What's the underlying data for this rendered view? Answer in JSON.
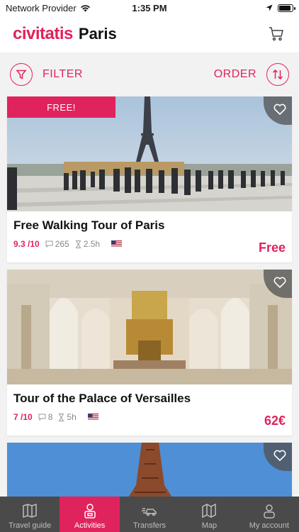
{
  "status": {
    "carrier": "Network Provider",
    "time": "1:35 PM",
    "battery_level": 0.9
  },
  "header": {
    "logo": "civitatis",
    "city": "Paris",
    "cart_icon": "cart-icon"
  },
  "toolbar": {
    "filter_label": "FILTER",
    "order_label": "ORDER",
    "filter_icon": "funnel-icon",
    "order_icon": "sort-arrows-icon"
  },
  "colors": {
    "brand": "#e0235c",
    "tab_bar": "#4a4a4a",
    "background": "#f2f2f2"
  },
  "activities": [
    {
      "badge": "FREE!",
      "title": "Free Walking Tour of Paris",
      "rating": "9.3 /10",
      "reviews": "265",
      "duration": "2.5h",
      "language_flag": "us-flag",
      "price": "Free"
    },
    {
      "title": "Tour of the Palace of Versailles",
      "rating": "7 /10",
      "reviews": "8",
      "duration": "5h",
      "language_flag": "us-flag",
      "price": "62€"
    },
    {
      "title": ""
    }
  ],
  "tabs": [
    {
      "label": "Travel guide",
      "icon": "map-book-icon",
      "active": false
    },
    {
      "label": "Activities",
      "icon": "person-badge-icon",
      "active": true
    },
    {
      "label": "Transfers",
      "icon": "car-icon",
      "active": false
    },
    {
      "label": "Map",
      "icon": "map-icon",
      "active": false
    },
    {
      "label": "My account",
      "icon": "user-icon",
      "active": false
    }
  ]
}
